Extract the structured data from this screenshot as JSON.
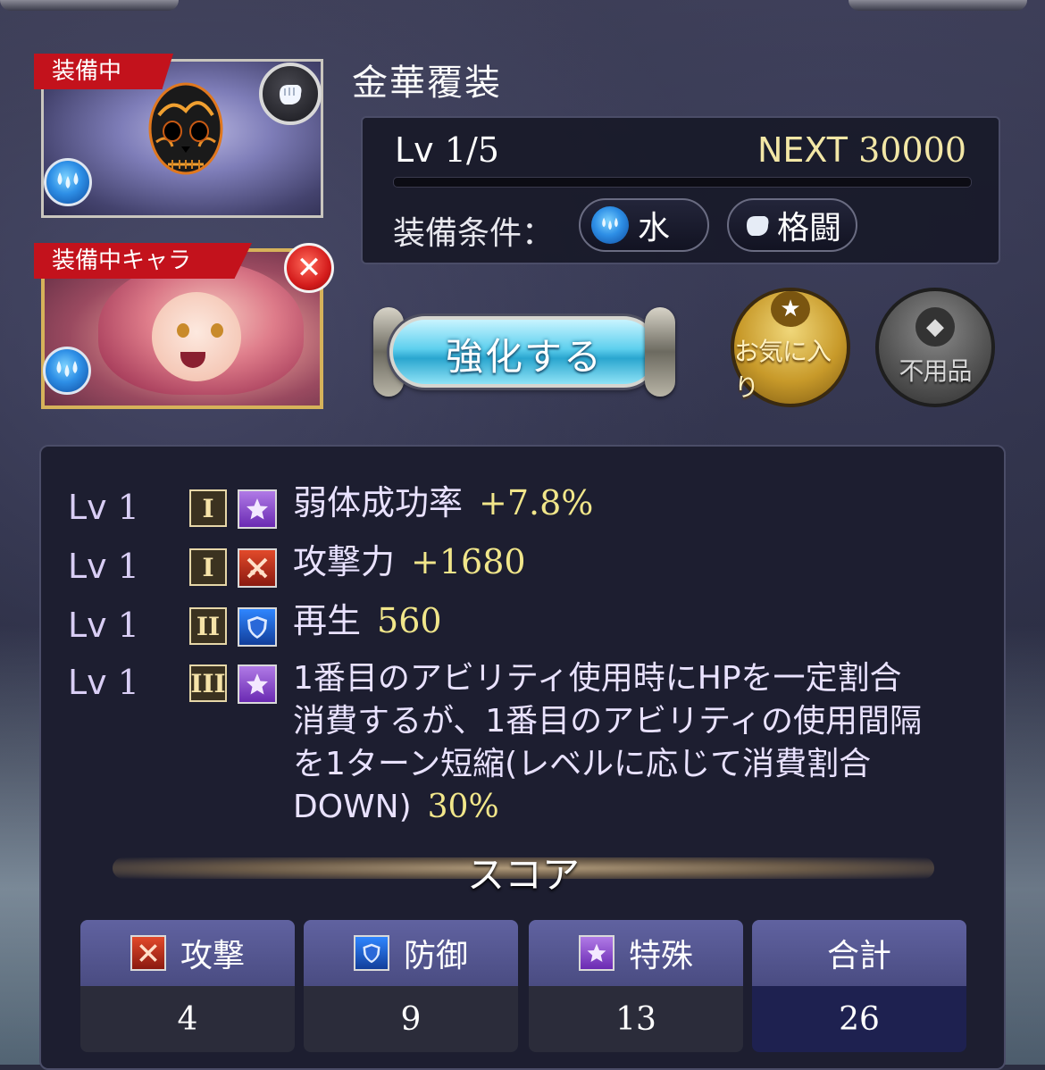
{
  "equipment": {
    "equipped_badge": "装備中",
    "name": "金華覆装",
    "element_icon": "water-icon",
    "type_icon": "glove-icon"
  },
  "character": {
    "equipped_badge": "装備中キャラ",
    "element_icon": "water-icon"
  },
  "info": {
    "lv_prefix": "Lv",
    "lv_value": "1/5",
    "next_prefix": "NEXT",
    "next_value": "30000",
    "exp_progress": 0,
    "condition_label": "装備条件：",
    "condition_element": "水",
    "condition_weapon": "格闘"
  },
  "actions": {
    "enhance_label": "強化する",
    "favorite_label": "お気に入り",
    "junk_label": "不用品"
  },
  "skills": [
    {
      "lv_prefix": "Lv",
      "lv": "1",
      "rank": "I",
      "type": "special",
      "name": "弱体成功率",
      "value": "+7.8%"
    },
    {
      "lv_prefix": "Lv",
      "lv": "1",
      "rank": "I",
      "type": "attack",
      "name": "攻撃力",
      "value": "+1680"
    },
    {
      "lv_prefix": "Lv",
      "lv": "1",
      "rank": "II",
      "type": "defense",
      "name": "再生",
      "value": "560"
    },
    {
      "lv_prefix": "Lv",
      "lv": "1",
      "rank": "III",
      "type": "special",
      "line1": "1番目のアビリティ使用時にHPを一定割合",
      "line2": "消費するが、1番目のアビリティの使用間隔",
      "line3": "を1ターン短縮(レベルに応じて消費割合",
      "line4": "DOWN)",
      "value": "30%"
    }
  ],
  "score": {
    "title": "スコア",
    "cells": [
      {
        "label": "攻撃",
        "value": "4",
        "icon": "attack-icon"
      },
      {
        "label": "防御",
        "value": "9",
        "icon": "shield-icon"
      },
      {
        "label": "特殊",
        "value": "13",
        "icon": "star-icon"
      },
      {
        "label": "合計",
        "value": "26"
      }
    ]
  },
  "colors": {
    "accent_gold": "#f1e68a",
    "badge_red": "#c3121c",
    "special_purple": "#8a4ad6",
    "attack_red": "#c22a18",
    "defense_blue": "#1f5fd0",
    "panel_bg": "#1d1e30"
  }
}
